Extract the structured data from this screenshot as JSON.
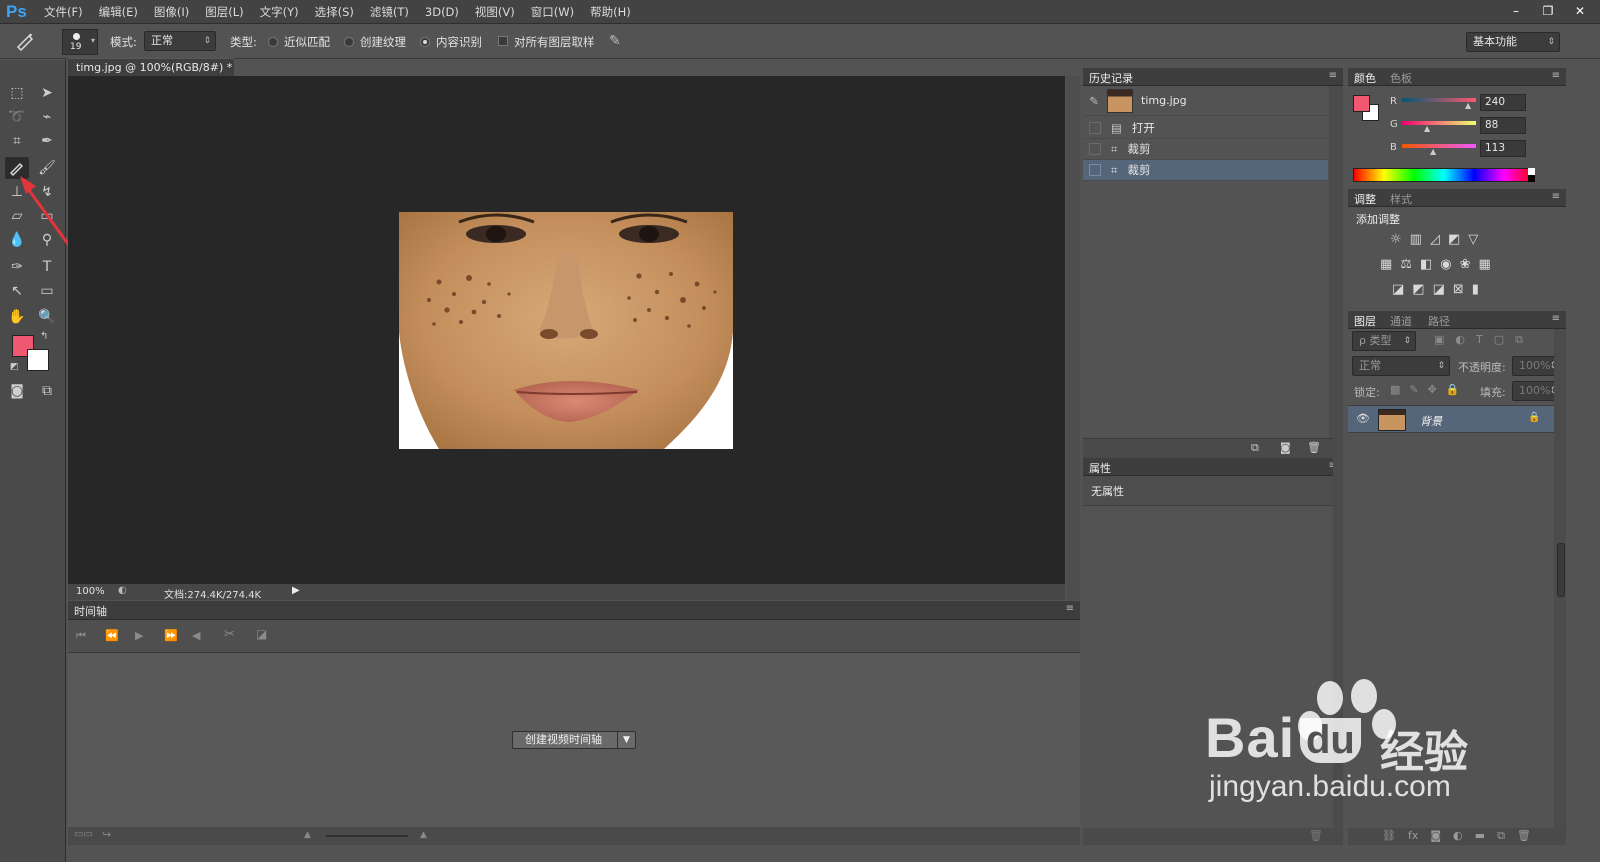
{
  "app": {
    "logo": "Ps"
  },
  "menu": [
    "文件(F)",
    "编辑(E)",
    "图像(I)",
    "图层(L)",
    "文字(Y)",
    "选择(S)",
    "滤镜(T)",
    "3D(D)",
    "视图(V)",
    "窗口(W)",
    "帮助(H)"
  ],
  "window_controls": {
    "minimize": "–",
    "restore": "❐",
    "close": "✕"
  },
  "options": {
    "brush_size": "19",
    "mode_label": "模式:",
    "mode_value": "正常",
    "type_label": "类型:",
    "type_options": [
      "近似匹配",
      "创建纹理",
      "内容识别"
    ],
    "type_selected": "内容识别",
    "sample_all_label": "对所有图层取样",
    "workspace": "基本功能"
  },
  "document": {
    "tab_title": "timg.jpg @ 100%(RGB/8#) *",
    "tab_close": "×",
    "zoom": "100%",
    "doc_info": "文档:274.4K/274.4K"
  },
  "timeline": {
    "title": "时间轴",
    "create_button": "创建视频时间轴"
  },
  "history": {
    "tabs": [
      "历史记录"
    ],
    "snapshot": "timg.jpg",
    "items": [
      "打开",
      "裁剪",
      "裁剪"
    ],
    "selected_index": 2
  },
  "properties": {
    "title": "属性",
    "content": "无属性"
  },
  "color": {
    "tabs": [
      "颜色",
      "色板"
    ],
    "foreground": "#f05871",
    "channels": [
      {
        "label": "R",
        "value": "240"
      },
      {
        "label": "G",
        "value": "88"
      },
      {
        "label": "B",
        "value": "113"
      }
    ]
  },
  "adjustments": {
    "tabs": [
      "调整",
      "样式"
    ],
    "add_label": "添加调整"
  },
  "layers": {
    "tabs": [
      "图层",
      "通道",
      "路径"
    ],
    "filter_label": "ρ 类型",
    "blend": "正常",
    "opacity_label": "不透明度:",
    "opacity_value": "100%",
    "lock_label": "锁定:",
    "fill_label": "填充:",
    "fill_value": "100%",
    "layer_name": "背景"
  },
  "watermark": {
    "brand": "Bai",
    "brand2": "du",
    "cn": "经验",
    "url": "jingyan.baidu.com"
  }
}
